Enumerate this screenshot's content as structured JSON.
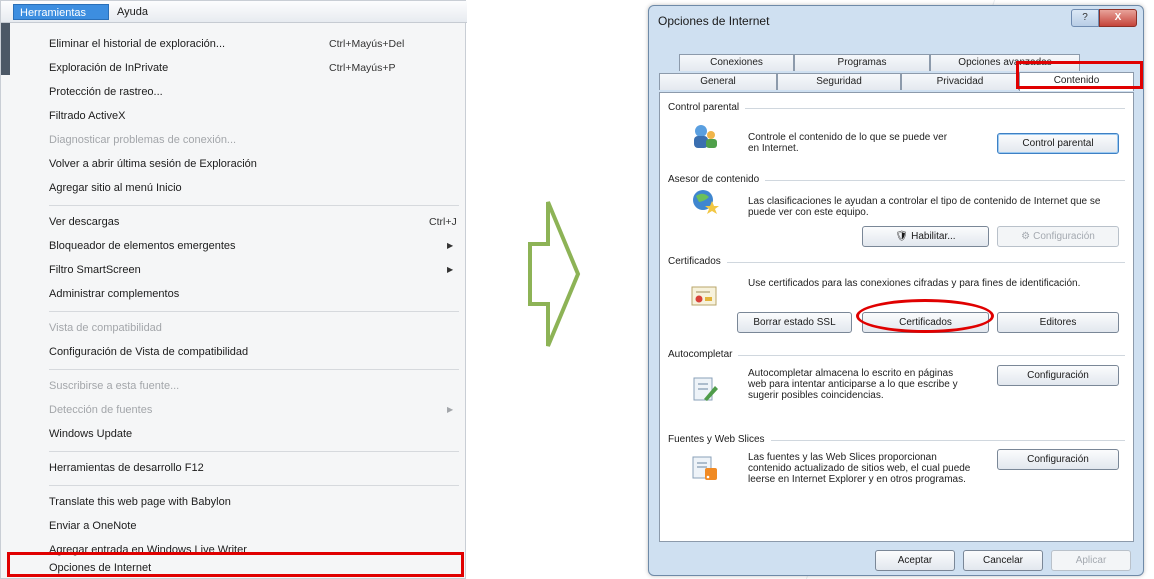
{
  "menubar": {
    "tools": "Herramientas",
    "help": "Ayuda"
  },
  "menu_items": [
    {
      "label": "Eliminar el historial de exploración...",
      "shortcut": "Ctrl+Mayús+Del"
    },
    {
      "label": "Exploración de InPrivate",
      "shortcut": "Ctrl+Mayús+P"
    },
    {
      "label": "Protección de rastreo..."
    },
    {
      "label": "Filtrado ActiveX"
    },
    {
      "label": "Diagnosticar problemas de conexión..."
    },
    {
      "label": "Volver a abrir última sesión de Exploración"
    },
    {
      "label": "Agregar sitio al menú Inicio"
    },
    {
      "label": "Ver descargas",
      "shortcut": "Ctrl+J"
    },
    {
      "label": "Bloqueador de elementos emergentes"
    },
    {
      "label": "Filtro SmartScreen"
    },
    {
      "label": "Administrar complementos"
    },
    {
      "label": "Vista de compatibilidad"
    },
    {
      "label": "Configuración de Vista de compatibilidad"
    },
    {
      "label": "Suscribirse a esta fuente..."
    },
    {
      "label": "Detección de fuentes"
    },
    {
      "label": "Windows Update"
    },
    {
      "label": "Herramientas de desarrollo F12"
    },
    {
      "label": "Translate this web page with Babylon"
    },
    {
      "label": "Enviar a OneNote"
    },
    {
      "label": "Agregar entrada en Windows Live Writer"
    },
    {
      "label": "Opciones de Internet"
    }
  ],
  "dialog": {
    "title": "Opciones de Internet",
    "title_buttons": {
      "help": "?",
      "close": "X"
    },
    "tabs_back": [
      "Conexiones",
      "Programas",
      "Opciones avanzadas"
    ],
    "tabs_front": [
      "General",
      "Seguridad",
      "Privacidad",
      "Contenido"
    ],
    "groups": {
      "parental": {
        "title": "Control parental",
        "desc": "Controle el contenido de lo que se puede ver en Internet.",
        "button": "Control parental"
      },
      "advisor": {
        "title": "Asesor de contenido",
        "desc": "Las clasificaciones le ayudan a controlar el tipo de contenido de Internet que se puede ver con este equipo.",
        "enable_button": "Habilitar...",
        "config_button": "Configuración"
      },
      "certificates": {
        "title": "Certificados",
        "desc": "Use certificados para las conexiones cifradas y para fines de identificación.",
        "clear_ssl_button": "Borrar estado SSL",
        "certificates_button": "Certificados",
        "publishers_button": "Editores"
      },
      "autocomplete": {
        "title": "Autocompletar",
        "desc": "Autocompletar almacena lo escrito en páginas web para intentar anticiparse a lo que escribe y sugerir posibles coincidencias.",
        "button": "Configuración"
      },
      "feeds": {
        "title": "Fuentes y Web Slices",
        "desc": "Las fuentes y las Web Slices proporcionan contenido actualizado de sitios web, el cual puede leerse en Internet Explorer y en otros programas.",
        "button": "Configuración"
      }
    },
    "footer": {
      "ok": "Aceptar",
      "cancel": "Cancelar",
      "apply": "Aplicar"
    }
  },
  "colors": {
    "highlight": "#e00000",
    "arrow": "#8db356",
    "menu_selected": "#3d8ee0"
  },
  "icons": [
    "parental-control-icon",
    "content-advisor-icon",
    "certificate-icon",
    "autocomplete-icon",
    "feeds-icon",
    "shield-icon",
    "gear-icon"
  ]
}
